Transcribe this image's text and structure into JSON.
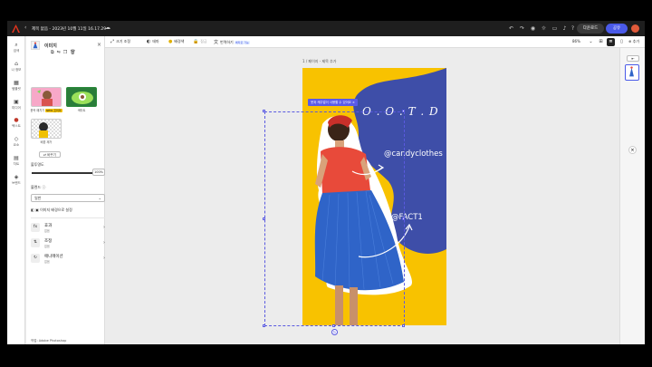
{
  "topbar": {
    "doc_title": "제목 없음 - 2023년 10월 11일 16.17.29",
    "download_label": "다운로드",
    "share_label": "공유"
  },
  "rail": {
    "items": [
      {
        "label": "검색",
        "icon": "search-icon"
      },
      {
        "label": "나 정보",
        "icon": "home-icon"
      },
      {
        "label": "템플릿",
        "icon": "template-icon"
      },
      {
        "label": "미디어",
        "icon": "media-icon"
      },
      {
        "label": "텍스트",
        "icon": "text-icon"
      },
      {
        "label": "요소",
        "icon": "elements-icon"
      },
      {
        "label": "차트",
        "icon": "chart-icon"
      },
      {
        "label": "브랜드",
        "icon": "brand-icon"
      }
    ]
  },
  "panel": {
    "title": "이미지",
    "styles": [
      {
        "label": "윤곽 패치기",
        "badge": "NEW 프리미"
      },
      {
        "label": "색마트"
      },
      {
        "label": "배경 제거"
      }
    ],
    "replace_label": "바꾸기",
    "opacity_label": "불투명도",
    "opacity_value": "100%",
    "blend_label": "블렌드",
    "blend_value": "일반",
    "remove_bg_label": "이미지 배경으로 설정",
    "effects": [
      {
        "name": "효과",
        "sub": "없음",
        "icon": "fx-icon"
      },
      {
        "name": "조정",
        "sub": "없음",
        "icon": "adjust-icon"
      },
      {
        "name": "애니메이션",
        "sub": "없음",
        "icon": "animation-icon"
      }
    ],
    "footer": "작업: Adobe Photoshop"
  },
  "toolbar": {
    "tools": [
      {
        "label": "크기 조정",
        "icon": "resize-icon"
      },
      {
        "label": "테마",
        "icon": "theme-icon"
      },
      {
        "label": "배경색",
        "icon": "bg-color-icon"
      },
      {
        "label": "잠금",
        "icon": "lock-icon",
        "disabled": true
      },
      {
        "label": "번역하기",
        "icon": "translate-icon",
        "beta": "베타로 가능"
      }
    ],
    "zoom": "86%",
    "add_label": "추가"
  },
  "canvas": {
    "page_label": "1 / 페이지 - 제목 추가",
    "tooltip": "옷과 캐주얼이 사용할 수 있어요",
    "ootd": "O . O . T . D",
    "handle1": "@candyclothes",
    "handle2": "@FACT1"
  },
  "colors": {
    "accent": "#4a5ae8",
    "artboard_yellow": "#f8c200",
    "blob_blue": "#3e4ea8",
    "skirt_blue": "#2f64c8",
    "top_red": "#e84a3a"
  }
}
